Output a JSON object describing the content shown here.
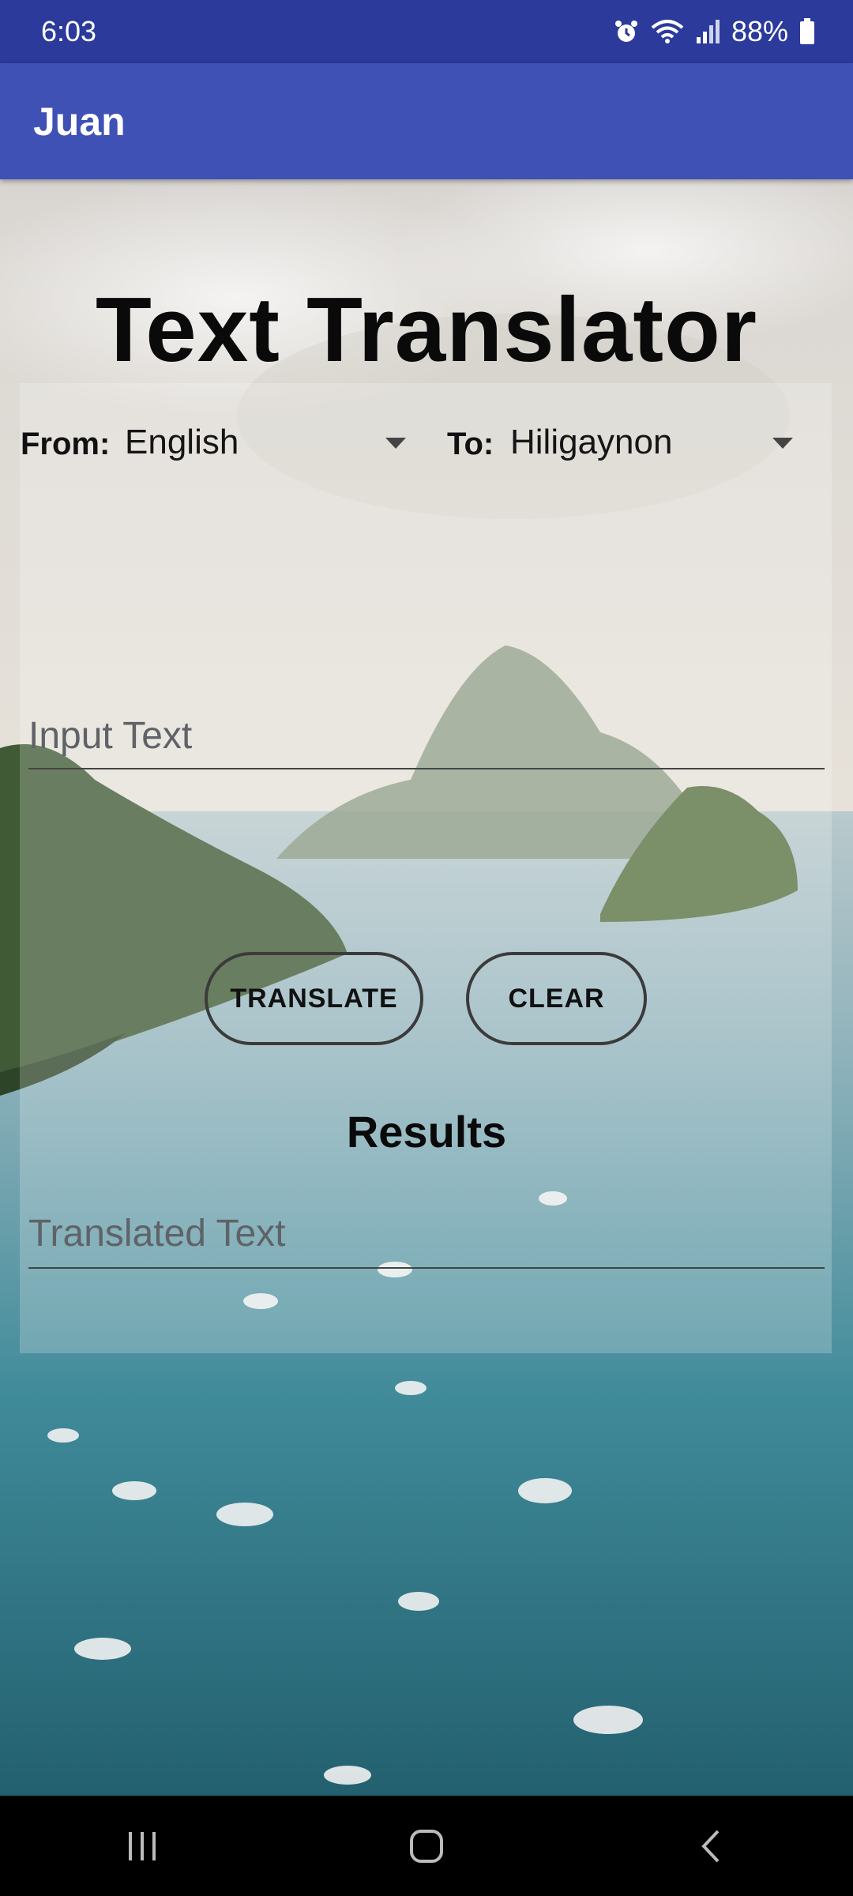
{
  "status_bar": {
    "time": "6:03",
    "battery": "88%",
    "icons": [
      "alarm-icon",
      "wifi-icon",
      "signal-icon",
      "battery-icon"
    ]
  },
  "app_bar": {
    "title": "Juan"
  },
  "main": {
    "heading": "Text Translator",
    "from_label": "From:",
    "from_value": "English",
    "to_label": "To:",
    "to_value": "Hiligaynon",
    "input_placeholder": "Input Text",
    "translate_label": "TRANSLATE",
    "clear_label": "CLEAR",
    "results_label": "Results",
    "output_placeholder": "Translated Text"
  },
  "nav_bar": {
    "buttons": [
      "recent-apps-icon",
      "home-icon",
      "back-icon"
    ]
  },
  "colors": {
    "status_bar": "#2b3a9b",
    "app_bar": "#3f51b5"
  }
}
